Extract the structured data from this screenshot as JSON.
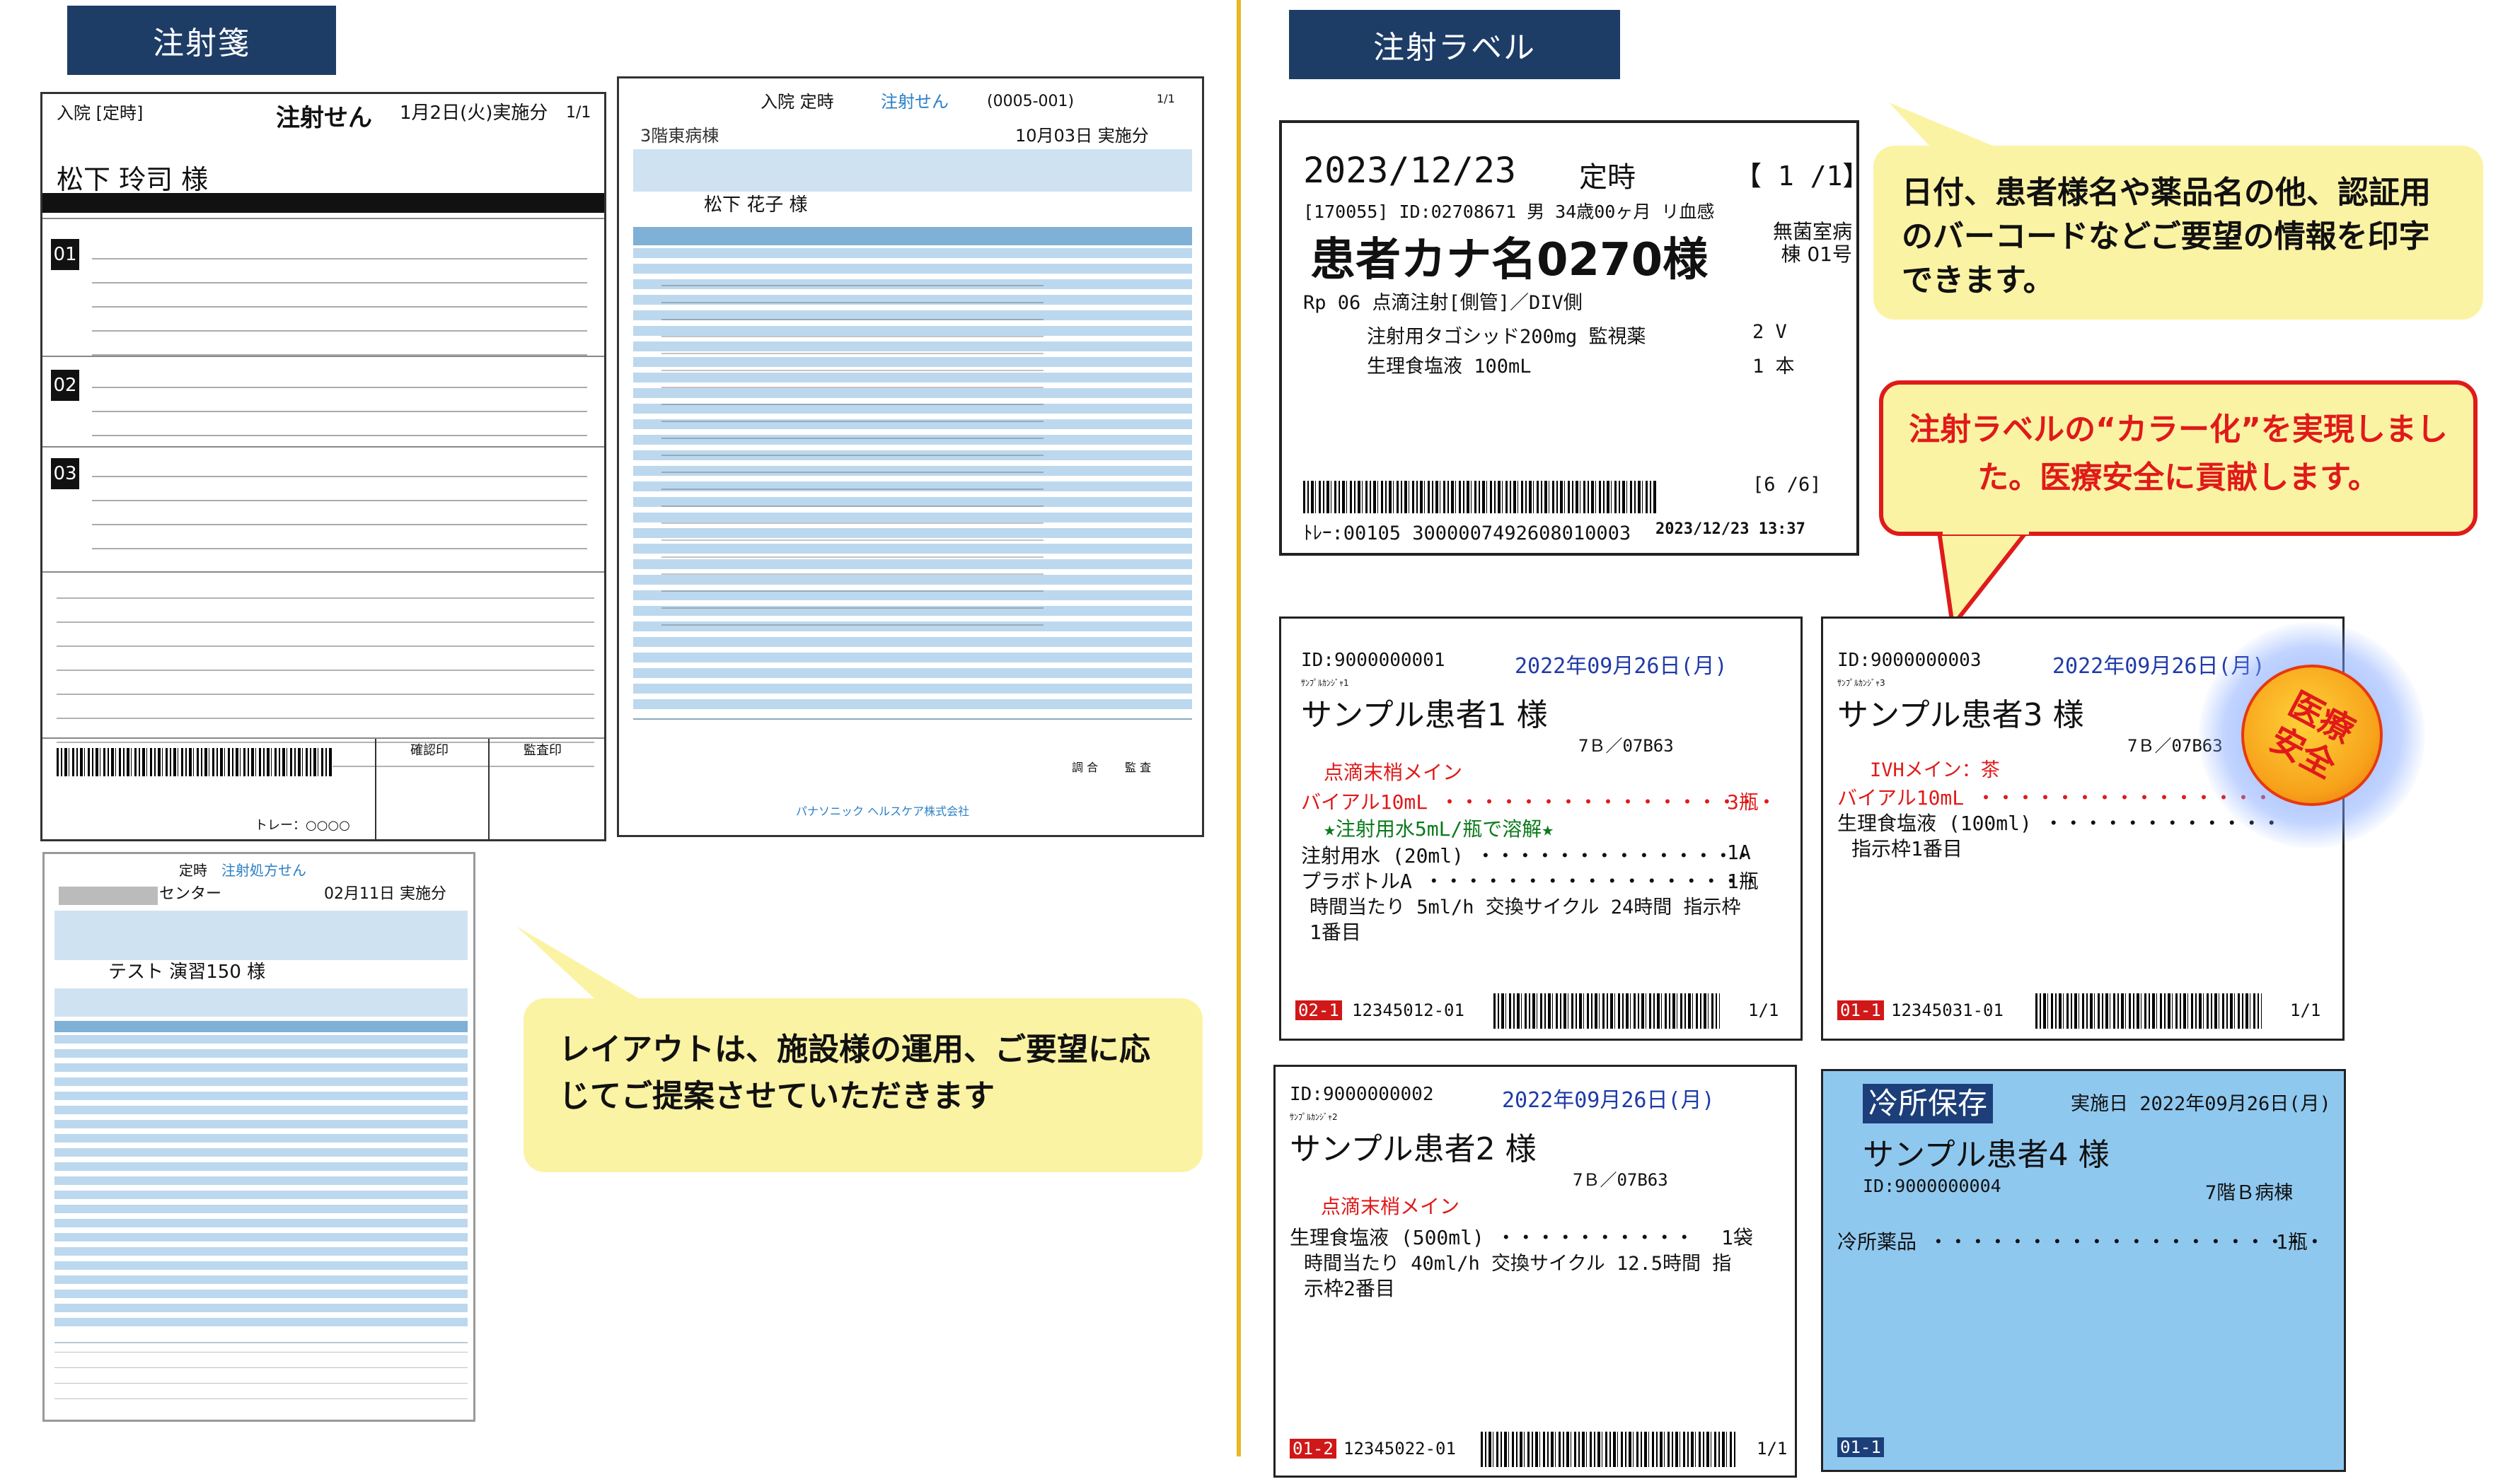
{
  "sections": {
    "left_title": "注射箋",
    "right_title": "注射ラベル"
  },
  "colors": {
    "header_bg": "#1d3d67",
    "divider": "#e9b724",
    "callout_yellow": "#fbf3a4",
    "callout_red_border": "#e01a1a",
    "label_blue": "#8fc8ef"
  },
  "prescription1": {
    "header_left": "入院 [定時]",
    "title": "注射せん",
    "date_text": "1月2日(火)実施分",
    "page": "1/1",
    "patient_name": "松下 玲司 様",
    "blocks": [
      "01",
      "02",
      "03"
    ],
    "footer": "トレー：○○○○",
    "stamp_cols": [
      "確認印",
      "監査印"
    ]
  },
  "prescription2": {
    "header": "入院 定時",
    "title": "注射せん",
    "code": "(0005-001)",
    "page": "1/1",
    "ward": "3階東病棟",
    "date_text": "10月03日 実施分",
    "patient_name": "松下 花子 様",
    "footer_company": "パナソニック ヘルスケア株式会社",
    "footer_cols": [
      "調 合",
      "監 査"
    ]
  },
  "prescription3": {
    "header": "定時",
    "title": "注射処方せん",
    "center": "センター",
    "date_text": "02月11日 実施分",
    "patient_name": "テスト 演習150 様"
  },
  "callouts": {
    "layout": "レイアウトは、施設様の運用、ご要望に応じてご提案させていただきます",
    "print_info": "日付、患者様名や薬品名の他、認証用のバーコードなどご要望の情報を印字できます。",
    "color_label": "注射ラベルの“カラー化”を実現しました。医療安全に貢献します。",
    "safety_badge": "医療安全"
  },
  "label_top": {
    "date": "2023/12/23",
    "schedule": "定時",
    "page_bracket": "【 1 /1】",
    "info": "[170055] ID:02708671 男 34歳00ヶ月 リ血感",
    "name": "患者カナ名0270様",
    "ward": "無菌室病棟 01号",
    "rp": "Rp 06 点滴注射[側管]／DIV側",
    "drug1": "注射用タゴシッド200mg 監視薬",
    "drug1_qty": "2 V",
    "drug2": "生理食塩液 100mL",
    "drug2_qty": "1 本",
    "count": "[6 /6]",
    "footer": "ﾄﾚｰ:00105 3000007492608010003",
    "footer_dt": "2023/12/23 13:37"
  },
  "label1": {
    "id": "ID:9000000001",
    "date": "2022年09月26日(月)",
    "kana": "ｻﾝﾌﾟﾙｶﾝｼﾞｬ1",
    "name": "サンプル患者1 様",
    "ward": "7Ｂ／07B63",
    "route": "点滴末梢メイン",
    "l1": "バイアル10mL ・・・・・・・・・・・・・・・・・",
    "l1_qty": "3瓶",
    "l2": "★注射用水5mL/瓶で溶解★",
    "l3": "注射用水 (20ml) ・・・・・・・・・・・・・・",
    "l3_qty": "1A",
    "l4": "プラボトルA ・・・・・・・・・・・・・・・・・",
    "l4_qty": "1瓶",
    "l5": "時間当たり 5ml/h 交換サイクル 24時間 指示枠",
    "l6": "1番目",
    "tag": "02-1",
    "code": "12345012-01",
    "page": "1/1"
  },
  "label2": {
    "id": "ID:9000000002",
    "date": "2022年09月26日(月)",
    "kana": "ｻﾝﾌﾟﾙｶﾝｼﾞｬ2",
    "name": "サンプル患者2 様",
    "ward": "7Ｂ／07B63",
    "route": "点滴末梢メイン",
    "l1": "生理食塩液 (500ml) ・・・・・・・・・・",
    "l1_qty": "1袋",
    "l2": "時間当たり 40ml/h 交換サイクル 12.5時間 指",
    "l3": "示枠2番目",
    "tag": "01-2",
    "code": "12345022-01",
    "page": "1/1"
  },
  "label3": {
    "id": "ID:9000000003",
    "date": "2022年09月26日(月)",
    "kana": "ｻﾝﾌﾟﾙｶﾝｼﾞｬ3",
    "name": "サンプル患者3 様",
    "ward": "7Ｂ／07B63",
    "route": "IVHメイン：茶",
    "l1": "バイアル10mL ・・・・・・・・・・・・・・・・・",
    "l2": "生理食塩液 (100ml) ・・・・・・・・・・・・",
    "l3": "指示枠1番目",
    "tag": "01-1",
    "code": "12345031-01",
    "page": "1/1"
  },
  "label4": {
    "badge": "冷所保存",
    "date": "実施日 2022年09月26日(月)",
    "name": "サンプル患者4 様",
    "id": "ID:9000000004",
    "ward": "7階Ｂ病棟",
    "l1": "冷所薬品 ・・・・・・・・・・・・・・・・・・・・",
    "l1_qty": "1瓶",
    "tag": "01-1"
  }
}
